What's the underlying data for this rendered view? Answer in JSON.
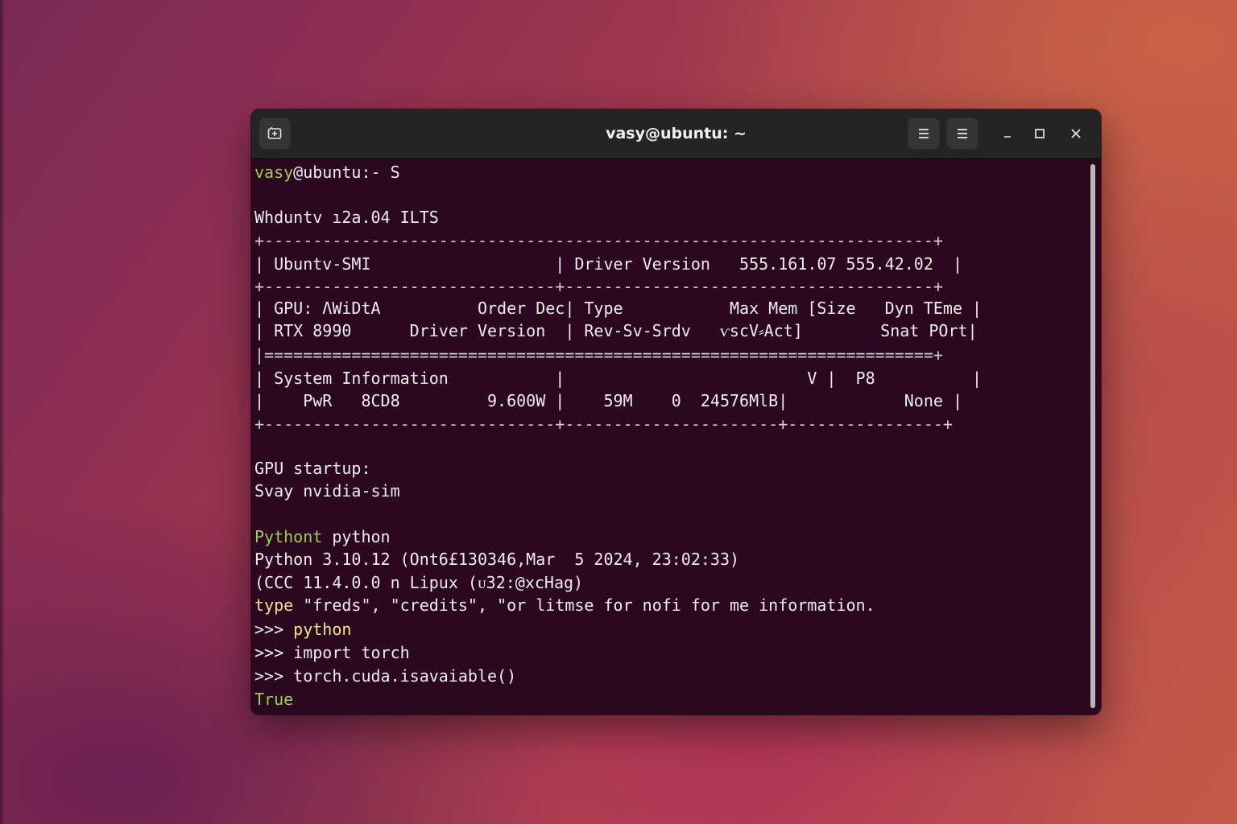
{
  "window": {
    "title": "vasy@ubuntu: ~"
  },
  "icons": {
    "new_tab": "new-tab-icon",
    "menu_1": "hamburger-menu-icon",
    "menu_2": "hamburger-menu-icon",
    "minimize": "minimize-icon",
    "maximize": "maximize-icon",
    "close": "close-icon"
  },
  "colors": {
    "terminal_bg": "#2c0720",
    "titlebar_bg": "#242424",
    "prompt_green": "#9ad14a",
    "text_yellow": "#eee58c",
    "text_default": "#ededed"
  },
  "terminal": {
    "prompt": {
      "user": "vasy",
      "host_path": "@ubuntu:- S"
    },
    "os_line": "Whduntv ı2a.04 ILTS",
    "table": {
      "border_top": "+---------------------------------------------------------------------+",
      "header_row": "| Ubuntv-SMI                   | Driver Version   555.161.07 555.42.02  |",
      "border_mid": "+------------------------------+--------------------------------------+",
      "row1": "| GPU: ΛWiDtA          Order Dec| Type           Max Mem [Size   Dyn TEme |",
      "row2": "| RTX 8990      Driver Version  | Rev-Sv-Srdv   ⱱscV⸗Act]        Snat POrt|",
      "border_double": "|=====================================================================+",
      "row3": "| System Information           |                         V |  P8          |",
      "row4": "|    PwR   8CD8         9.600W |    59M    0  24576MlB|            None |",
      "border_bottom": "+------------------------------+----------------------+----------------+"
    },
    "gpu_startup": "GPU startup:",
    "svay_cmd": "Svay nvidia-sim",
    "python_prompt": "Pythont",
    "python_cmd": " python",
    "python_version": "Python 3.10.12 (Ont6£130346,Mar  5 2024, 23:02:33)",
    "gcc_line": "(CCC 11.4.0.0 n Lipux (ᴜ32:@xcHag)",
    "type_kw": "type",
    "type_rest": " \"freds\", \"credits\", \"or litmse for nofi for me information.",
    "repl_prompt": ">>>",
    "repl_cmd1": " python",
    "repl_cmd2": " import torch",
    "repl_cmd3": " torch.cuda.isavaiable()",
    "result": "True"
  }
}
